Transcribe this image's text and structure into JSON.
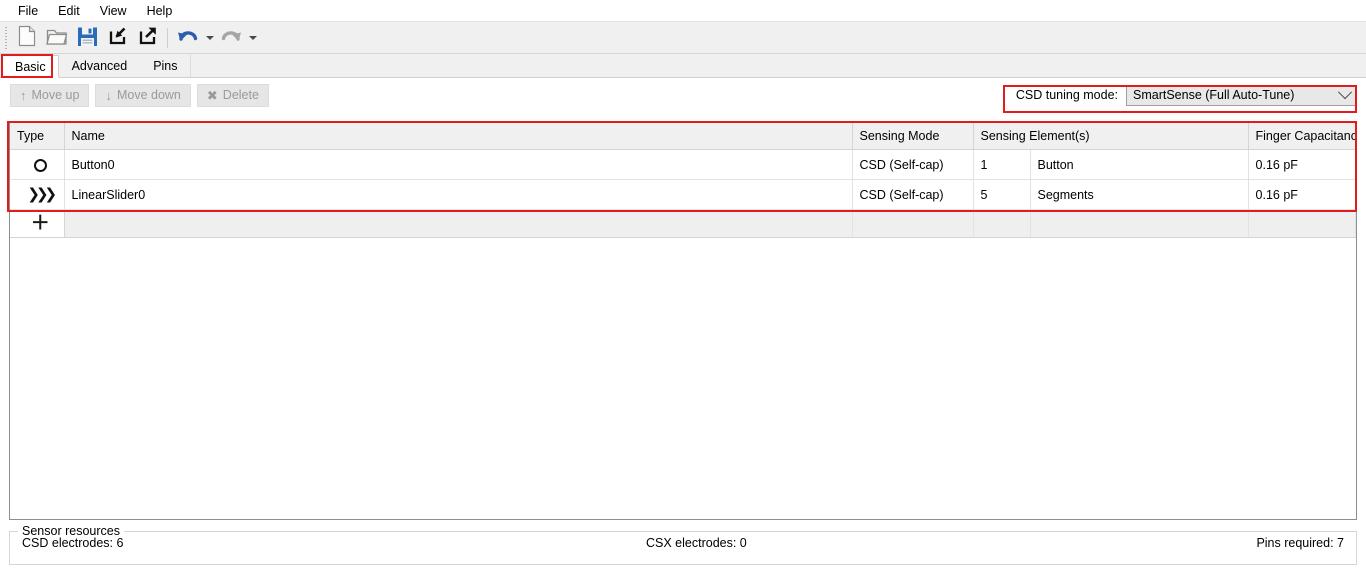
{
  "menu": {
    "items": [
      {
        "label": "File"
      },
      {
        "label": "Edit"
      },
      {
        "label": "View"
      },
      {
        "label": "Help"
      }
    ]
  },
  "toolbar": {
    "buttons": [
      {
        "name": "new-file-icon",
        "title": "New"
      },
      {
        "name": "open-folder-icon",
        "title": "Open"
      },
      {
        "name": "save-icon",
        "title": "Save"
      },
      {
        "name": "import-icon",
        "title": "Import"
      },
      {
        "name": "export-icon",
        "title": "Export"
      },
      {
        "name": "undo-icon",
        "title": "Undo"
      },
      {
        "name": "redo-icon",
        "title": "Redo"
      }
    ]
  },
  "tabs": [
    {
      "label": "Basic",
      "active": true
    },
    {
      "label": "Advanced",
      "active": false
    },
    {
      "label": "Pins",
      "active": false
    }
  ],
  "commandbar": {
    "move_up_label": "Move up",
    "move_down_label": "Move down",
    "delete_label": "Delete",
    "move_up_glyph": "↑",
    "move_down_glyph": "↓",
    "delete_glyph": "✖",
    "tuning_label": "CSD tuning mode:",
    "tuning_value": "SmartSense (Full Auto-Tune)"
  },
  "table": {
    "headers": [
      "Type",
      "Name",
      "Sensing Mode",
      "Sensing Element(s)",
      "Finger Capacitance"
    ],
    "rows": [
      {
        "type_icon": "circle-icon",
        "name": "Button0",
        "sensing_mode": "CSD (Self-cap)",
        "element_count": "1",
        "element_label": "Button",
        "finger_capacitance": "0.16 pF"
      },
      {
        "type_icon": "slider-icon",
        "name": "LinearSlider0",
        "sensing_mode": "CSD (Self-cap)",
        "element_count": "5",
        "element_label": "Segments",
        "finger_capacitance": "0.16 pF"
      }
    ],
    "add_row_glyph": "＋"
  },
  "resources": {
    "legend": "Sensor resources",
    "csd_electrodes": "CSD electrodes:  6",
    "csx_electrodes": "CSX electrodes:  0",
    "pins_required": "Pins required:  7"
  },
  "colors": {
    "annotation": "#e21b1b",
    "toolbar_bg": "#f0f0f0",
    "undo_enabled": "#2b5fad",
    "redo_disabled": "#a6a6a6"
  }
}
